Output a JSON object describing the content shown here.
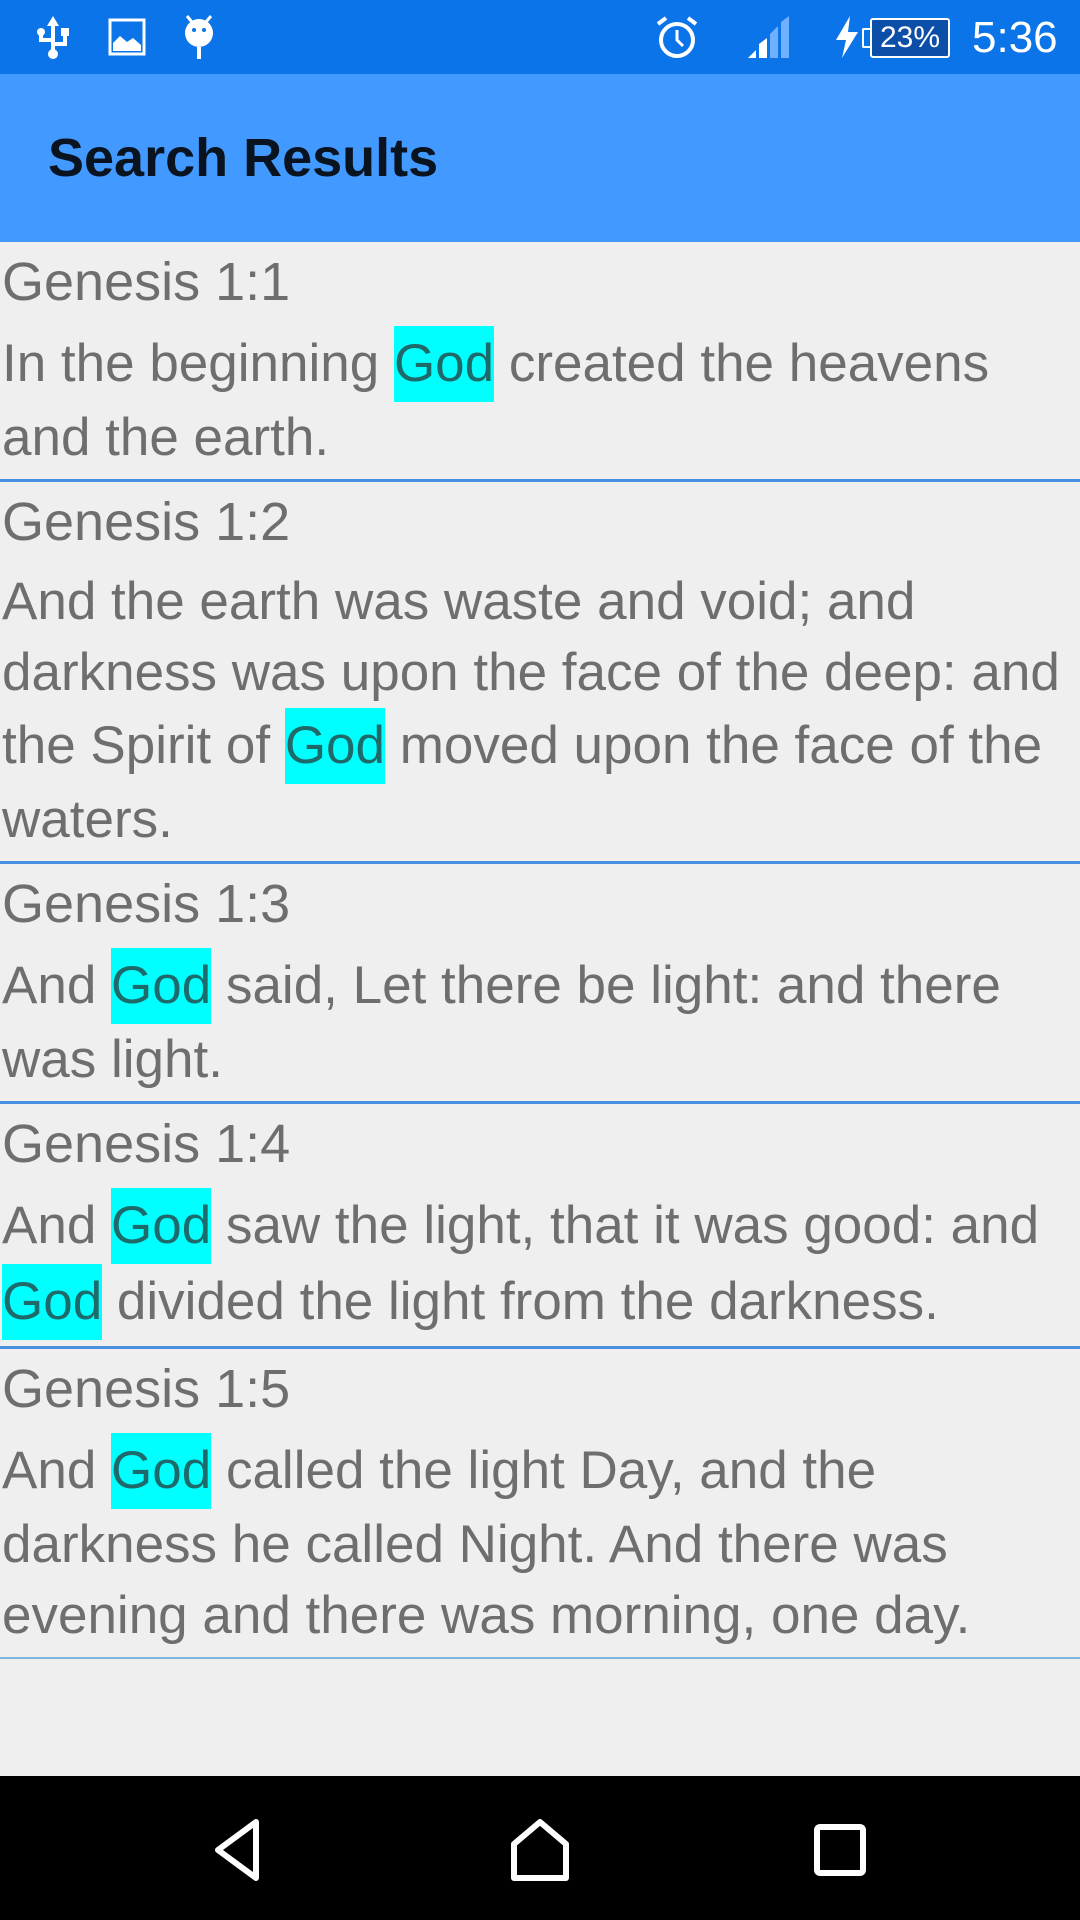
{
  "status_bar": {
    "left_icons": [
      "usb-icon",
      "image-icon",
      "android-debug-icon"
    ],
    "right_icons": [
      "alarm-icon",
      "signal-icon",
      "charging-icon"
    ],
    "battery_percent": "23%",
    "time": "5:36"
  },
  "app_bar": {
    "title": "Search Results"
  },
  "search": {
    "highlight_term": "God",
    "highlight_color": "#00ffff"
  },
  "results": [
    {
      "reference": "Genesis 1:1",
      "segments": [
        {
          "text": " In the beginning ",
          "hl": false
        },
        {
          "text": "God",
          "hl": true
        },
        {
          "text": " created the heavens and the earth.",
          "hl": false
        }
      ]
    },
    {
      "reference": "Genesis 1:2",
      "segments": [
        {
          "text": " And the earth was waste and void; and darkness was upon the face of the deep: and the Spirit of ",
          "hl": false
        },
        {
          "text": "God",
          "hl": true
        },
        {
          "text": " moved upon the face of the waters.",
          "hl": false
        }
      ]
    },
    {
      "reference": "Genesis 1:3",
      "segments": [
        {
          "text": " And ",
          "hl": false
        },
        {
          "text": "God",
          "hl": true
        },
        {
          "text": " said, Let there be light: and there was light.",
          "hl": false
        }
      ]
    },
    {
      "reference": "Genesis 1:4",
      "segments": [
        {
          "text": " And ",
          "hl": false
        },
        {
          "text": "God",
          "hl": true
        },
        {
          "text": " saw the light, that it was good: and ",
          "hl": false
        },
        {
          "text": "God",
          "hl": true
        },
        {
          "text": " divided the light from the darkness.",
          "hl": false
        }
      ]
    },
    {
      "reference": "Genesis 1:5",
      "segments": [
        {
          "text": " And ",
          "hl": false
        },
        {
          "text": "God",
          "hl": true
        },
        {
          "text": " called the light Day, and the darkness he called Night. And there was evening and there was morning, one day.",
          "hl": false
        }
      ]
    }
  ],
  "nav_bar": {
    "buttons": [
      "back-icon",
      "home-icon",
      "recents-icon"
    ]
  },
  "colors": {
    "status_bar": "#0a74e8",
    "app_bar": "#4299ff",
    "divider": "#4a90e2",
    "text": "#6e6e6e",
    "background": "#efefef"
  }
}
